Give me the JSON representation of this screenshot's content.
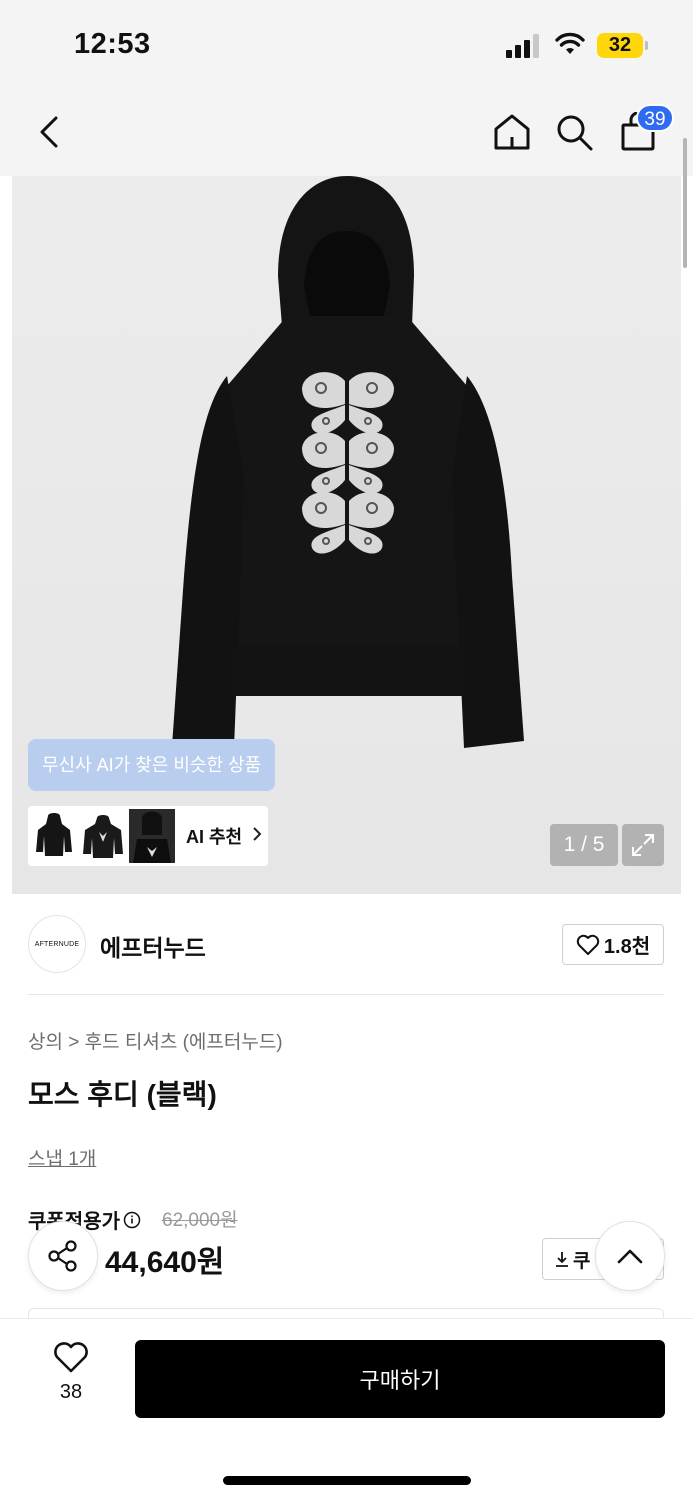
{
  "status_bar": {
    "time": "12:53",
    "battery": "32"
  },
  "nav": {
    "cart_count": "39",
    "icons": [
      "back-icon",
      "home-icon",
      "search-icon",
      "shopping-bag-icon"
    ]
  },
  "gallery": {
    "ai_tooltip": "무신사 AI가 찾은 비슷한 상품",
    "ai_recommend_label": "AI 추천",
    "pager": "1 / 5"
  },
  "brand": {
    "logo_text": "AFTERNUDE",
    "name": "에프터누드",
    "like_count": "1.8천"
  },
  "product": {
    "breadcrumb_category": "상의",
    "breadcrumb_sub": "후드 티셔츠 (에프터누드)",
    "title": "모스 후디 (블랙)",
    "snap": "스냅 1개",
    "price_label": "쿠폰적용가",
    "original_price": "62,000원",
    "price": "44,640원",
    "coupon_label": "쿠"
  },
  "bottom_bar": {
    "like_count": "38",
    "buy_label": "구매하기"
  },
  "colors": {
    "accent": "#2f6bf0",
    "tooltip": "#b9cdef",
    "buy": "#000000"
  }
}
